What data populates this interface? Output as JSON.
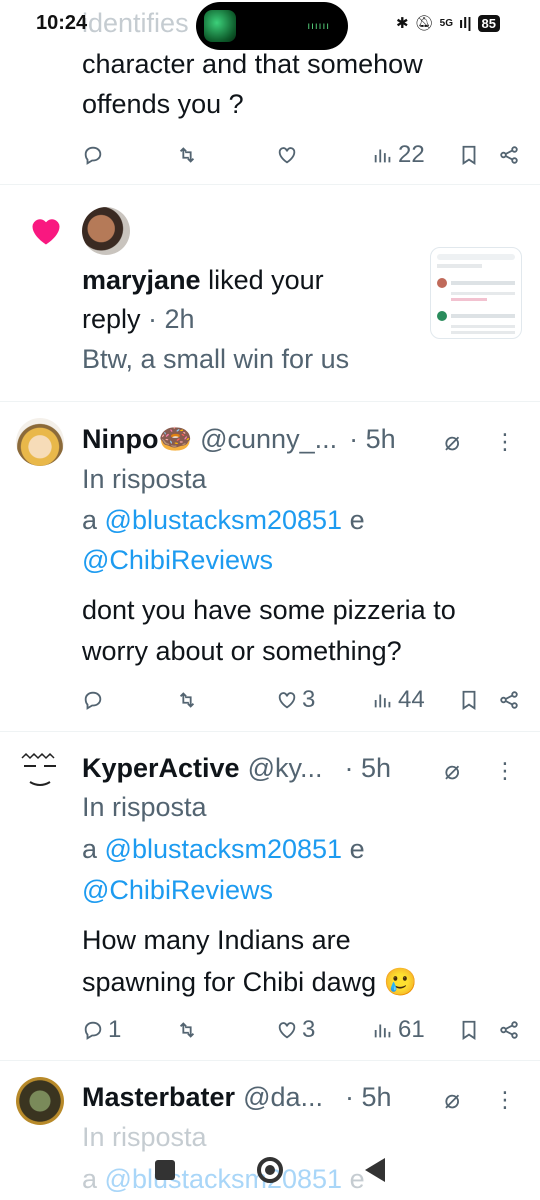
{
  "status_bar": {
    "time": "10:24",
    "network": "5G",
    "battery": "85"
  },
  "top_tweet": {
    "faded_line": "identifies as a female",
    "text_line1": "character and that somehow",
    "text_line2": "offends you ?",
    "actions": {
      "views": "22"
    }
  },
  "notification": {
    "user": "maryjane",
    "action": " liked your",
    "line2": "reply",
    "time": "2h",
    "snippet": "Btw, a small win for us"
  },
  "tweets": [
    {
      "name": "Ninpo🍩",
      "handle": "@cunny_...",
      "time": "5h",
      "reply_label": "In risposta",
      "reply_to_prefix": "a ",
      "reply_to_1": "@blustacksm20851",
      "reply_join": " e",
      "reply_to_2": "@ChibiReviews",
      "text_line1": "dont you have some pizzeria to",
      "text_line2": "worry about or something?",
      "replies": "",
      "likes": "3",
      "views": "44"
    },
    {
      "name": "KyperActive",
      "handle": "@ky...",
      "time": "5h",
      "reply_label": "In risposta",
      "reply_to_prefix": "a ",
      "reply_to_1": "@blustacksm20851",
      "reply_join": " e",
      "reply_to_2": "@ChibiReviews",
      "text_line1": "How many Indians are",
      "text_line2": "spawning for Chibi dawg 🥲",
      "replies": "1",
      "likes": "3",
      "views": "61"
    },
    {
      "name": "Masterbater",
      "handle": "@da...",
      "time": "5h",
      "reply_label": "In risposta",
      "reply_to_prefix": "a ",
      "reply_to_1": "@blustacksm20851",
      "reply_join": " e"
    }
  ],
  "colors": {
    "accent": "#1d9bf0",
    "like": "#f91880",
    "muted": "#536471"
  }
}
